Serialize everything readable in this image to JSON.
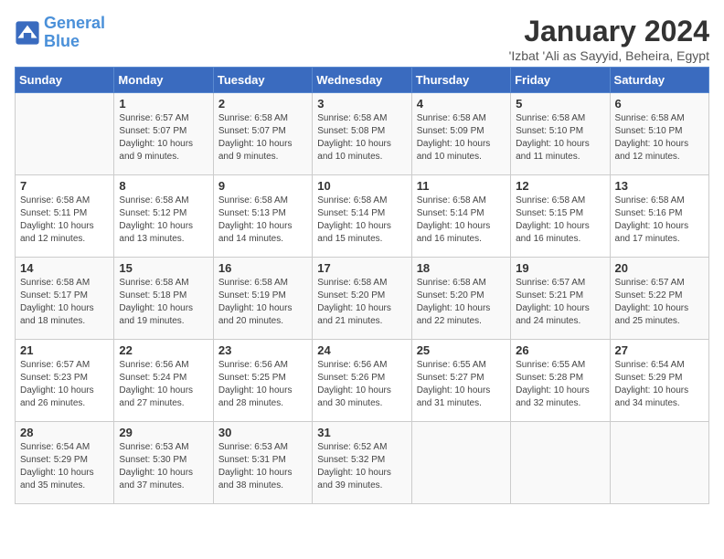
{
  "logo": {
    "line1": "General",
    "line2": "Blue"
  },
  "title": "January 2024",
  "subtitle": "'Izbat 'Ali as Sayyid, Beheira, Egypt",
  "days_header": [
    "Sunday",
    "Monday",
    "Tuesday",
    "Wednesday",
    "Thursday",
    "Friday",
    "Saturday"
  ],
  "weeks": [
    [
      {
        "day": "",
        "sunrise": "",
        "sunset": "",
        "daylight": ""
      },
      {
        "day": "1",
        "sunrise": "Sunrise: 6:57 AM",
        "sunset": "Sunset: 5:07 PM",
        "daylight": "Daylight: 10 hours and 9 minutes."
      },
      {
        "day": "2",
        "sunrise": "Sunrise: 6:58 AM",
        "sunset": "Sunset: 5:07 PM",
        "daylight": "Daylight: 10 hours and 9 minutes."
      },
      {
        "day": "3",
        "sunrise": "Sunrise: 6:58 AM",
        "sunset": "Sunset: 5:08 PM",
        "daylight": "Daylight: 10 hours and 10 minutes."
      },
      {
        "day": "4",
        "sunrise": "Sunrise: 6:58 AM",
        "sunset": "Sunset: 5:09 PM",
        "daylight": "Daylight: 10 hours and 10 minutes."
      },
      {
        "day": "5",
        "sunrise": "Sunrise: 6:58 AM",
        "sunset": "Sunset: 5:10 PM",
        "daylight": "Daylight: 10 hours and 11 minutes."
      },
      {
        "day": "6",
        "sunrise": "Sunrise: 6:58 AM",
        "sunset": "Sunset: 5:10 PM",
        "daylight": "Daylight: 10 hours and 12 minutes."
      }
    ],
    [
      {
        "day": "7",
        "sunrise": "Sunrise: 6:58 AM",
        "sunset": "Sunset: 5:11 PM",
        "daylight": "Daylight: 10 hours and 12 minutes."
      },
      {
        "day": "8",
        "sunrise": "Sunrise: 6:58 AM",
        "sunset": "Sunset: 5:12 PM",
        "daylight": "Daylight: 10 hours and 13 minutes."
      },
      {
        "day": "9",
        "sunrise": "Sunrise: 6:58 AM",
        "sunset": "Sunset: 5:13 PM",
        "daylight": "Daylight: 10 hours and 14 minutes."
      },
      {
        "day": "10",
        "sunrise": "Sunrise: 6:58 AM",
        "sunset": "Sunset: 5:14 PM",
        "daylight": "Daylight: 10 hours and 15 minutes."
      },
      {
        "day": "11",
        "sunrise": "Sunrise: 6:58 AM",
        "sunset": "Sunset: 5:14 PM",
        "daylight": "Daylight: 10 hours and 16 minutes."
      },
      {
        "day": "12",
        "sunrise": "Sunrise: 6:58 AM",
        "sunset": "Sunset: 5:15 PM",
        "daylight": "Daylight: 10 hours and 16 minutes."
      },
      {
        "day": "13",
        "sunrise": "Sunrise: 6:58 AM",
        "sunset": "Sunset: 5:16 PM",
        "daylight": "Daylight: 10 hours and 17 minutes."
      }
    ],
    [
      {
        "day": "14",
        "sunrise": "Sunrise: 6:58 AM",
        "sunset": "Sunset: 5:17 PM",
        "daylight": "Daylight: 10 hours and 18 minutes."
      },
      {
        "day": "15",
        "sunrise": "Sunrise: 6:58 AM",
        "sunset": "Sunset: 5:18 PM",
        "daylight": "Daylight: 10 hours and 19 minutes."
      },
      {
        "day": "16",
        "sunrise": "Sunrise: 6:58 AM",
        "sunset": "Sunset: 5:19 PM",
        "daylight": "Daylight: 10 hours and 20 minutes."
      },
      {
        "day": "17",
        "sunrise": "Sunrise: 6:58 AM",
        "sunset": "Sunset: 5:20 PM",
        "daylight": "Daylight: 10 hours and 21 minutes."
      },
      {
        "day": "18",
        "sunrise": "Sunrise: 6:58 AM",
        "sunset": "Sunset: 5:20 PM",
        "daylight": "Daylight: 10 hours and 22 minutes."
      },
      {
        "day": "19",
        "sunrise": "Sunrise: 6:57 AM",
        "sunset": "Sunset: 5:21 PM",
        "daylight": "Daylight: 10 hours and 24 minutes."
      },
      {
        "day": "20",
        "sunrise": "Sunrise: 6:57 AM",
        "sunset": "Sunset: 5:22 PM",
        "daylight": "Daylight: 10 hours and 25 minutes."
      }
    ],
    [
      {
        "day": "21",
        "sunrise": "Sunrise: 6:57 AM",
        "sunset": "Sunset: 5:23 PM",
        "daylight": "Daylight: 10 hours and 26 minutes."
      },
      {
        "day": "22",
        "sunrise": "Sunrise: 6:56 AM",
        "sunset": "Sunset: 5:24 PM",
        "daylight": "Daylight: 10 hours and 27 minutes."
      },
      {
        "day": "23",
        "sunrise": "Sunrise: 6:56 AM",
        "sunset": "Sunset: 5:25 PM",
        "daylight": "Daylight: 10 hours and 28 minutes."
      },
      {
        "day": "24",
        "sunrise": "Sunrise: 6:56 AM",
        "sunset": "Sunset: 5:26 PM",
        "daylight": "Daylight: 10 hours and 30 minutes."
      },
      {
        "day": "25",
        "sunrise": "Sunrise: 6:55 AM",
        "sunset": "Sunset: 5:27 PM",
        "daylight": "Daylight: 10 hours and 31 minutes."
      },
      {
        "day": "26",
        "sunrise": "Sunrise: 6:55 AM",
        "sunset": "Sunset: 5:28 PM",
        "daylight": "Daylight: 10 hours and 32 minutes."
      },
      {
        "day": "27",
        "sunrise": "Sunrise: 6:54 AM",
        "sunset": "Sunset: 5:29 PM",
        "daylight": "Daylight: 10 hours and 34 minutes."
      }
    ],
    [
      {
        "day": "28",
        "sunrise": "Sunrise: 6:54 AM",
        "sunset": "Sunset: 5:29 PM",
        "daylight": "Daylight: 10 hours and 35 minutes."
      },
      {
        "day": "29",
        "sunrise": "Sunrise: 6:53 AM",
        "sunset": "Sunset: 5:30 PM",
        "daylight": "Daylight: 10 hours and 37 minutes."
      },
      {
        "day": "30",
        "sunrise": "Sunrise: 6:53 AM",
        "sunset": "Sunset: 5:31 PM",
        "daylight": "Daylight: 10 hours and 38 minutes."
      },
      {
        "day": "31",
        "sunrise": "Sunrise: 6:52 AM",
        "sunset": "Sunset: 5:32 PM",
        "daylight": "Daylight: 10 hours and 39 minutes."
      },
      {
        "day": "",
        "sunrise": "",
        "sunset": "",
        "daylight": ""
      },
      {
        "day": "",
        "sunrise": "",
        "sunset": "",
        "daylight": ""
      },
      {
        "day": "",
        "sunrise": "",
        "sunset": "",
        "daylight": ""
      }
    ]
  ]
}
